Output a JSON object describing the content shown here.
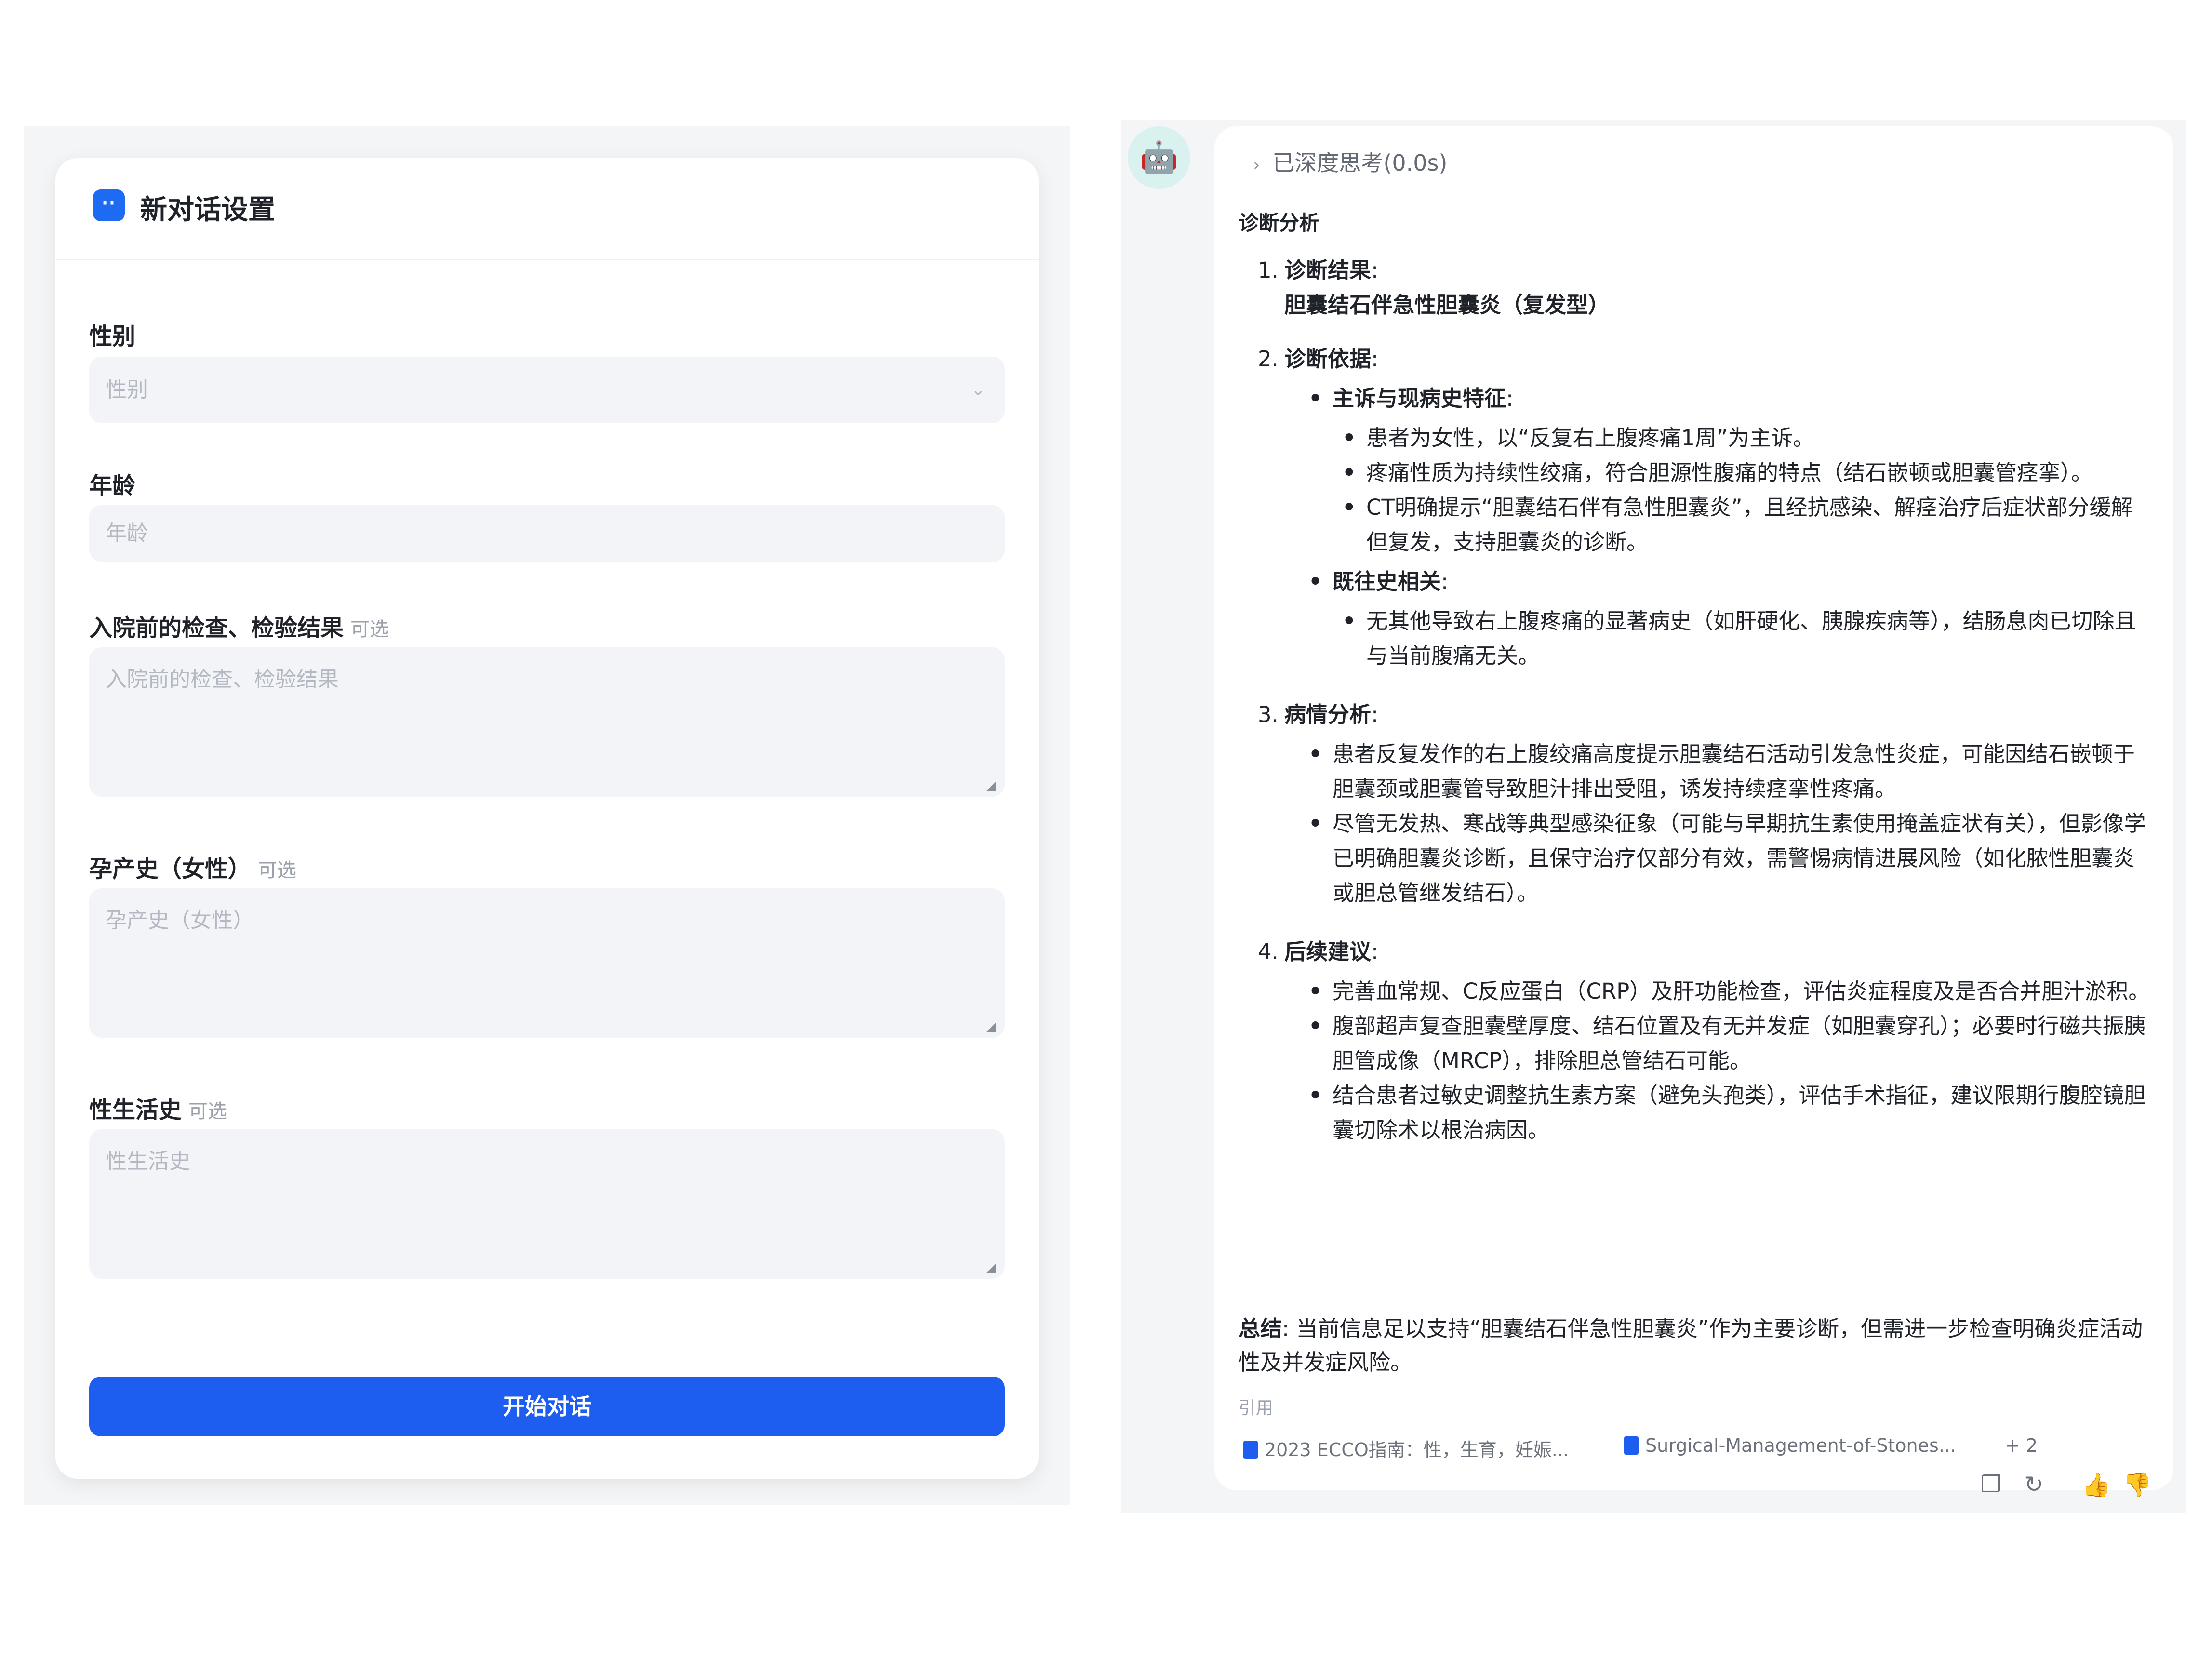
{
  "left": {
    "title": "新对话设置",
    "header_icon_glyph": "··",
    "fields": [
      {
        "label": "性别",
        "placeholder": "性别",
        "type": "select"
      },
      {
        "label": "年龄",
        "placeholder": "年龄",
        "type": "input"
      },
      {
        "label": "入院前的检查、检验结果",
        "optional": "可选",
        "placeholder": "入院前的检查、检验结果",
        "type": "textarea"
      },
      {
        "label": "孕产史（女性）",
        "optional": "可选",
        "placeholder": "孕产史（女性）",
        "type": "textarea"
      },
      {
        "label": "性生活史",
        "optional": "可选",
        "placeholder": "性生活史",
        "type": "textarea"
      }
    ],
    "start_button": "开始对话"
  },
  "right": {
    "thinking": "已深度思考(0.0s)",
    "heading": "诊断分析",
    "sections": [
      {
        "num": "1.",
        "title": "诊断结果",
        "result": "胆囊结石伴急性胆囊炎（复发型）"
      },
      {
        "num": "2.",
        "title": "诊断依据",
        "groups": [
          {
            "title": "主诉与现病史特征",
            "items": [
              "患者为女性，以“反复右上腹疼痛1周”为主诉。",
              "疼痛性质为持续性绞痛，符合胆源性腹痛的特点（结石嵌顿或胆囊管痉挛）。",
              "CT明确提示“胆囊结石伴有急性胆囊炎”，且经抗感染、解痉治疗后症状部分缓解但复发，支持胆囊炎的诊断。"
            ]
          },
          {
            "title": "既往史相关",
            "items": [
              "无其他导致右上腹疼痛的显著病史（如肝硬化、胰腺疾病等），结肠息肉已切除且与当前腹痛无关。"
            ]
          }
        ]
      },
      {
        "num": "3.",
        "title": "病情分析",
        "items": [
          "患者反复发作的右上腹绞痛高度提示胆囊结石活动引发急性炎症，可能因结石嵌顿于胆囊颈或胆囊管导致胆汁排出受阻，诱发持续痉挛性疼痛。",
          "尽管无发热、寒战等典型感染征象（可能与早期抗生素使用掩盖症状有关），但影像学已明确胆囊炎诊断，且保守治疗仅部分有效，需警惕病情进展风险（如化脓性胆囊炎或胆总管继发结石）。"
        ]
      },
      {
        "num": "4.",
        "title": "后续建议",
        "items": [
          "完善血常规、C反应蛋白（CRP）及肝功能检查，评估炎症程度及是否合并胆汁淤积。",
          "腹部超声复查胆囊壁厚度、结石位置及有无并发症（如胆囊穿孔）；必要时行磁共振胰胆管成像（MRCP），排除胆总管结石可能。",
          "结合患者过敏史调整抗生素方案（避免头孢类），评估手术指征，建议限期行腹腔镜胆囊切除术以根治病因。"
        ]
      }
    ],
    "summary_label": "总结",
    "summary_text": "当前信息足以支持“胆囊结石伴急性胆囊炎”作为主要诊断，但需进一步检查明确炎症活动性及并发症风险。",
    "cite_label": "引用",
    "citations": [
      "2023 ECCO指南：性，生育，妊娠...",
      "Surgical-Management-of-Stones...",
      "+ 2"
    ],
    "actions": [
      "copy-icon",
      "refresh-icon",
      "thumbs-up-icon",
      "thumbs-down-icon"
    ]
  }
}
